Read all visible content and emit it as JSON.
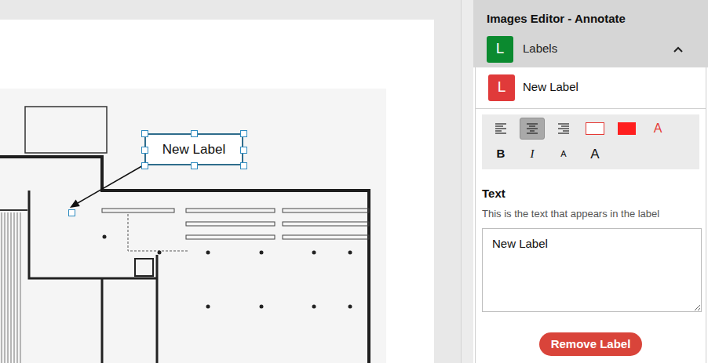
{
  "canvas": {
    "label": {
      "text": "New Label",
      "selected": true
    }
  },
  "panel": {
    "title": "Images Editor - Annotate",
    "section": {
      "icon": "L",
      "label": "Labels",
      "expanded": true,
      "color": "#0b8a2f"
    },
    "items": [
      {
        "icon": "L",
        "name": "New Label",
        "color": "#e03a3a"
      }
    ],
    "toolbar": {
      "align": [
        {
          "kind": "left",
          "selected": false
        },
        {
          "kind": "center",
          "selected": true
        },
        {
          "kind": "right",
          "selected": false
        }
      ],
      "colors": [
        {
          "kind": "border",
          "color": "#e53935"
        },
        {
          "kind": "fill",
          "color": "#ff1f1f"
        },
        {
          "kind": "text",
          "text": "A",
          "color": "#e53935"
        }
      ],
      "format": [
        {
          "kind": "bold",
          "text": "B"
        },
        {
          "kind": "italic",
          "text": "I"
        },
        {
          "kind": "smaller",
          "text": "A"
        },
        {
          "kind": "larger",
          "text": "A"
        }
      ]
    },
    "text_field": {
      "label": "Text",
      "help": "This is the text that appears in the label",
      "value": "New Label"
    },
    "remove_button": "Remove Label"
  }
}
